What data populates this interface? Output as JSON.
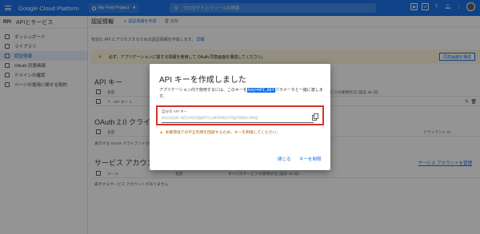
{
  "topbar": {
    "brand": "Google Cloud Platform",
    "project": "My First Project",
    "search_placeholder": "プロダクトとリソースの検索",
    "icons": [
      "cloud-shell-icon",
      "notifications-icon",
      "help-icon",
      "more-vert-icon",
      "account-avatar"
    ]
  },
  "sidebar": {
    "api_label": "RPI",
    "title": "APIとサービス",
    "items": [
      {
        "label": "ダッシュボード"
      },
      {
        "label": "ライブラリ"
      },
      {
        "label": "認証情報"
      },
      {
        "label": "OAuth 同意画面"
      },
      {
        "label": "ドメインの確認"
      },
      {
        "label": "ページの使用に関する契約"
      }
    ]
  },
  "main": {
    "title": "認証情報",
    "create_label": "＋ 認証情報を作成",
    "delete_label": "削除",
    "description": "有効な API にアクセスするための認証情報を作成します。",
    "description_link": "詳細",
    "warning_text": "必ず、アプリケーションに関する情報を使用して OAuth 同意画面を構成してください。",
    "warning_button": "同意画面を構成",
    "api_keys_heading": "API キー",
    "api_keys_columns": [
      "名前",
      "すべてのサービスの使用状況 (過去 30 日)"
    ],
    "api_key_row": "API キー 1",
    "oauth_heading": "OAuth 2.0 クライアント",
    "oauth_columns": [
      "名前",
      "クライアント ID"
    ],
    "oauth_empty": "表示する OAuth クライアントがありません",
    "sa_heading": "サービス アカウント",
    "sa_manage_link": "サービス アカウントを管理",
    "sa_columns": [
      "メール",
      "名前",
      "すべてのサービスの使用状況 (過去 30 日)"
    ],
    "sa_empty": "表示するサービス アカウントがありません"
  },
  "dialog": {
    "title": "API キーを作成しました",
    "body_before": "アプリケーション内で使用するには、このキーを",
    "body_code": "key=API_KEY",
    "body_after": "パラメータと一緒に渡します。",
    "key_label": "自分の API キー",
    "key_value": "AIzaSyB-mZ1vXk3QpR7tLwE9hN2cF5gYdU8sJ0oQ",
    "warning": "本番環境での不正利用を回避するため、キーを制限してください。",
    "close_button": "閉じる",
    "restrict_button": "キーを制限"
  }
}
